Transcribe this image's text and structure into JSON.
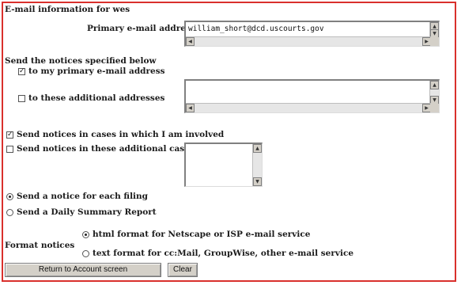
{
  "header": {
    "title": "E-mail information for wes"
  },
  "primary": {
    "label": "Primary e-mail address",
    "value": "william_short@dcd.uscourts.gov"
  },
  "notices_section": {
    "heading": "Send the notices specified below",
    "to_primary": {
      "label": "to my primary e-mail address",
      "checked": true
    },
    "to_additional": {
      "label": "to these additional addresses",
      "checked": false,
      "value": ""
    }
  },
  "cases": {
    "involved": {
      "label": "Send notices in cases in which I am involved",
      "checked": true
    },
    "additional": {
      "label": "Send notices in these additional cases",
      "checked": false,
      "value": ""
    }
  },
  "frequency": {
    "each_filing": {
      "label": "Send a notice for each filing",
      "selected": true
    },
    "daily_summary": {
      "label": "Send a Daily Summary Report",
      "selected": false
    }
  },
  "format": {
    "label": "Format notices",
    "html": {
      "label": "html format for Netscape or ISP e-mail service",
      "selected": true
    },
    "text": {
      "label": "text format for cc:Mail, GroupWise, other e-mail service",
      "selected": false
    }
  },
  "buttons": {
    "return_label": "Return to Account screen",
    "clear_label": "Clear"
  },
  "colors": {
    "frame_border": "#d9302c",
    "button_face": "#d4d0c8"
  }
}
